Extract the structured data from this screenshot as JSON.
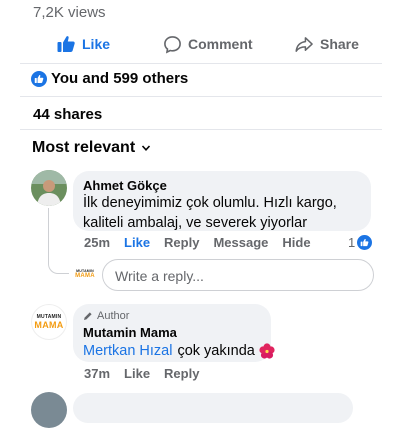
{
  "post": {
    "views": "7,2K views",
    "actions": {
      "like": "Like",
      "comment": "Comment",
      "share": "Share"
    },
    "reactions_text": "You and 599 others",
    "shares_text": "44 shares",
    "sort_label": "Most relevant"
  },
  "comments": [
    {
      "author": "Ahmet Gökçe",
      "text": "İlk deneyimimiz çok olumlu. Hızlı kargo, kaliteli ambalaj, ve severek yiyorlar",
      "time": "25m",
      "like": "Like",
      "reply": "Reply",
      "message": "Message",
      "hide": "Hide",
      "reaction_count": "1"
    },
    {
      "badge": "Author",
      "author": "Mutamin Mama",
      "mention": "Mertkan Hızal",
      "text": "çok yakında",
      "time": "37m",
      "like": "Like",
      "reply": "Reply"
    }
  ],
  "reply_box": {
    "placeholder": "Write a reply..."
  },
  "logo": {
    "line1": "MUTAMIN",
    "line2": "MAMA"
  },
  "colors": {
    "accent": "#1b74e4",
    "muted": "#65676b",
    "bubble": "#f0f2f5",
    "logo_orange": "#f39c12"
  },
  "icons": [
    "thumbs-up-icon",
    "comment-icon",
    "share-icon",
    "chevron-down-icon",
    "pencil-icon",
    "hibiscus-icon"
  ]
}
